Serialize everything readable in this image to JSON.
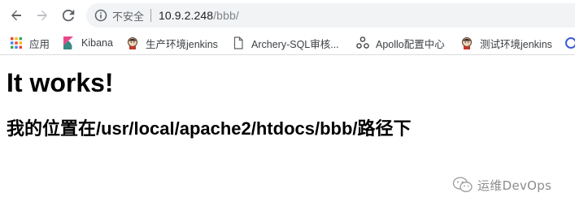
{
  "browser": {
    "security_label": "不安全",
    "url_host": "10.9.2.248",
    "url_path": "/bbb/"
  },
  "bookmarks": [
    {
      "label": "应用",
      "icon": "apps-grid-icon"
    },
    {
      "label": "Kibana",
      "icon": "kibana-icon"
    },
    {
      "label": "生产环境jenkins",
      "icon": "jenkins-icon"
    },
    {
      "label": "Archery-SQL审核...",
      "icon": "page-icon"
    },
    {
      "label": "Apollo配置中心",
      "icon": "apollo-icon"
    },
    {
      "label": "测试环境jenkins",
      "icon": "jenkins-icon"
    }
  ],
  "page": {
    "heading": "It works!",
    "subheading": "我的位置在/usr/local/apache2/htdocs/bbb/路径下"
  },
  "watermark": {
    "text": "运维DevOps"
  },
  "colors": {
    "apps_grid": [
      "#ea4335",
      "#fbbc04",
      "#34a853",
      "#4285f4"
    ],
    "kibana": [
      "#e8488b",
      "#3ebeb0",
      "#343741"
    ]
  }
}
